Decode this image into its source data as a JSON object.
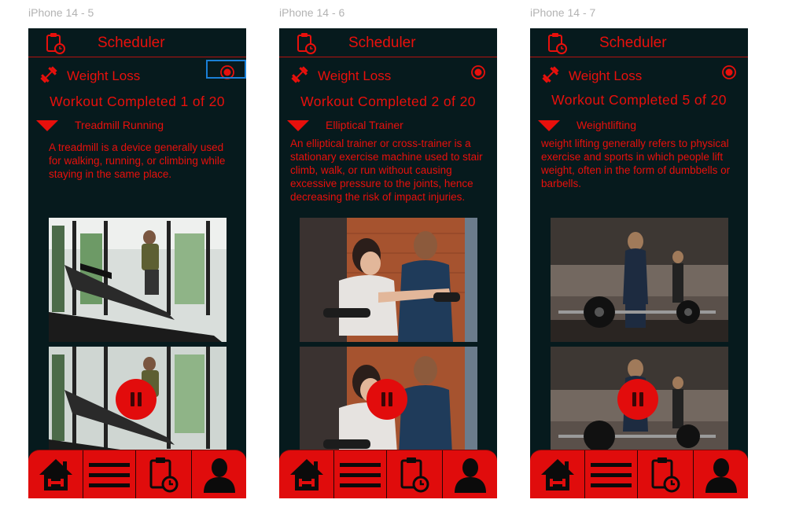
{
  "colors": {
    "accent": "#e8100c",
    "background": "#061a1d",
    "nav": "#e00c0c",
    "selection": "#1a7fd6"
  },
  "frames": [
    {
      "frame_label": "iPhone 14 - 5",
      "header": {
        "title": "Scheduler",
        "icon": "clipboard-clock-icon"
      },
      "category": "Weight Loss",
      "progress_text": "Workout Completed 1 of 20",
      "exercise": {
        "name": "Treadmill Running"
      },
      "description": "A treadmill is a device generally used for walking, running, or climbing while staying in the same place.",
      "nav": [
        "home-icon",
        "menu-icon",
        "schedule-icon",
        "profile-icon"
      ]
    },
    {
      "frame_label": "iPhone 14 - 6",
      "header": {
        "title": "Scheduler",
        "icon": "clipboard-clock-icon"
      },
      "category": "Weight Loss",
      "progress_text": "Workout Completed 2 of 20",
      "exercise": {
        "name": "Elliptical Trainer"
      },
      "description": "An elliptical trainer or cross-trainer is a stationary exercise machine used to stair climb, walk, or run without causing excessive pressure to the joints, hence decreasing the risk of impact injuries.",
      "nav": [
        "home-icon",
        "menu-icon",
        "schedule-icon",
        "profile-icon"
      ]
    },
    {
      "frame_label": "iPhone 14 - 7",
      "header": {
        "title": "Scheduler",
        "icon": "clipboard-clock-icon"
      },
      "category": "Weight Loss",
      "progress_text": "Workout Completed 5 of 20",
      "exercise": {
        "name": "Weightlifting"
      },
      "description": "weight lifting generally refers to physical exercise and sports in which people lift weight, often in the form of dumbbells or barbells.",
      "nav": [
        "home-icon",
        "menu-icon",
        "schedule-icon",
        "profile-icon"
      ]
    }
  ]
}
